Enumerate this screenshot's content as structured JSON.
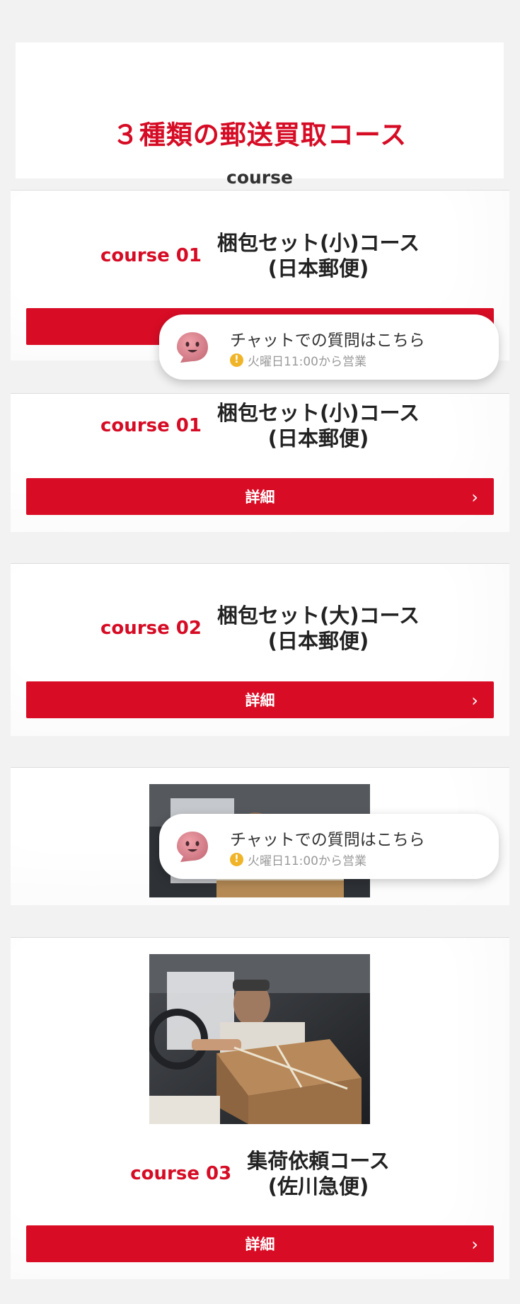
{
  "header": {
    "title": "３種類の郵送買取コース",
    "subtitle": "course"
  },
  "courses": [
    {
      "number": "course 01",
      "name_line1": "梱包セット(小)コース",
      "name_line2": "(日本郵便)",
      "button": "詳細"
    },
    {
      "number": "course 01",
      "name_line1": "梱包セット(小)コース",
      "name_line2": "(日本郵便)",
      "button": "詳細"
    },
    {
      "number": "course 02",
      "name_line1": "梱包セット(大)コース",
      "name_line2": "(日本郵便)",
      "button": "詳細"
    },
    {
      "number": "course 03",
      "name_line1": "集荷依頼コース",
      "name_line2": "(佐川急便)",
      "button": "詳細"
    }
  ],
  "chat": {
    "title": "チャットでの質問はこちら",
    "status": "火曜日11:00から営業",
    "status_icon": "warning-icon",
    "avatar_icon": "chat-mascot-icon"
  },
  "colors": {
    "accent": "#d60c25",
    "background": "#f2f2f2",
    "warning": "#f0b429"
  },
  "icons": {
    "button_chevron": "›"
  }
}
